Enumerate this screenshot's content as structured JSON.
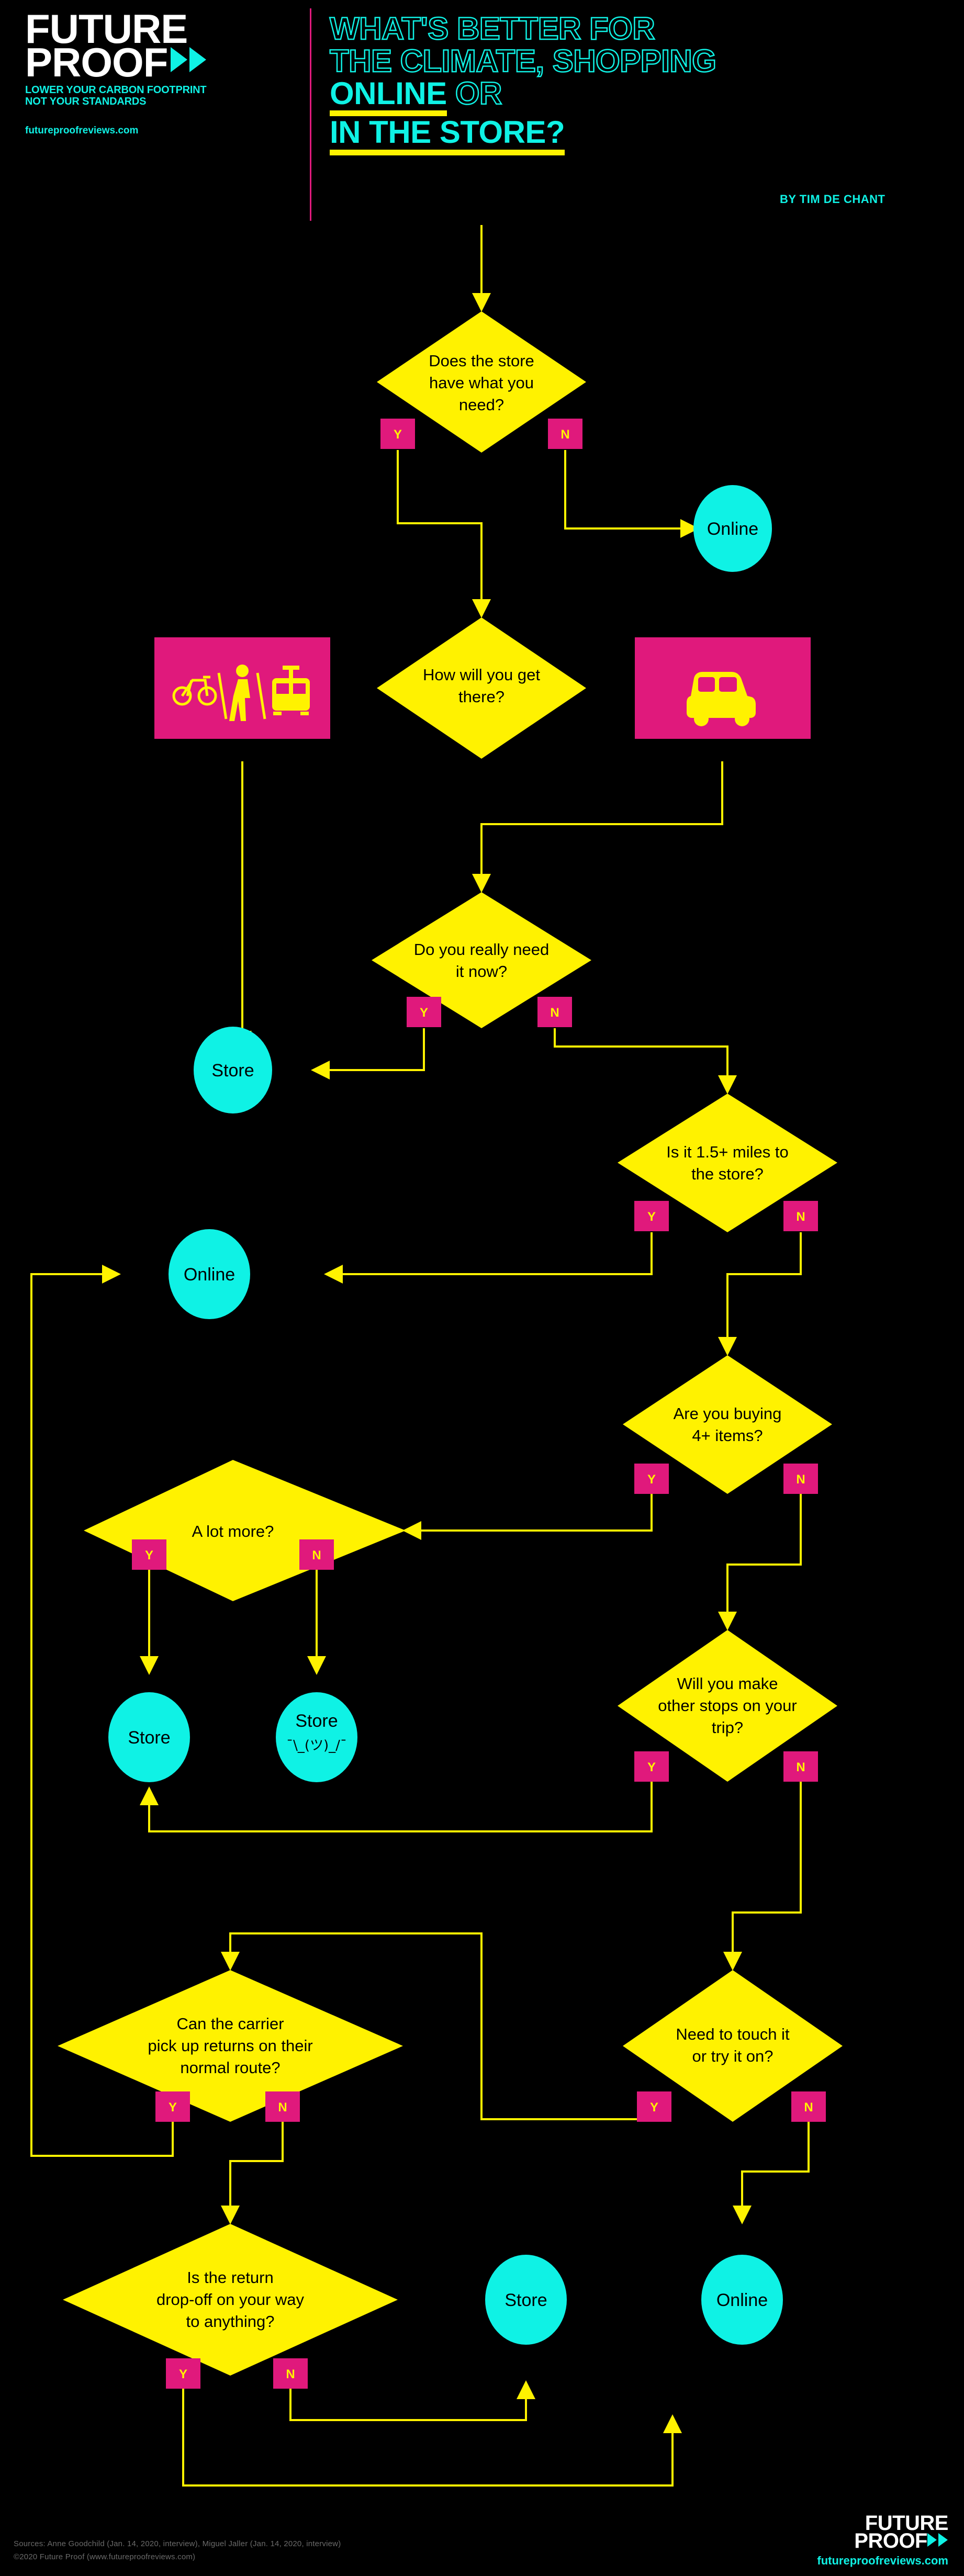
{
  "brand": {
    "name_line1": "FUTURE",
    "name_line2": "PROOF",
    "tagline_line1": "LOWER YOUR CARBON FOOTPRINT",
    "tagline_line2": "NOT YOUR STANDARDS",
    "url": "futureproofreviews.com"
  },
  "header": {
    "title_line1": "WHAT'S BETTER FOR",
    "title_line2": "THE CLIMATE, SHOPPING",
    "title_line3_hl": "ONLINE",
    "title_line3_rest": "OR",
    "title_line4": "IN THE STORE?",
    "byline": "BY TIM DE CHANT"
  },
  "colors": {
    "background": "#000000",
    "decision": "#FFF200",
    "terminal": "#0FF2E5",
    "branch_badge": "#E0197C",
    "connector": "#FFF200",
    "accent_rule": "#E0197C"
  },
  "flow": {
    "yes_label": "Y",
    "no_label": "N",
    "nodes": [
      {
        "id": "q1",
        "type": "decision",
        "lines": [
          "Does the store",
          "have what you",
          "need?"
        ]
      },
      {
        "id": "t1",
        "type": "terminal",
        "lines": [
          "Online"
        ]
      },
      {
        "id": "q2",
        "type": "decision",
        "lines": [
          "How will you get",
          "there?"
        ]
      },
      {
        "id": "m1",
        "type": "mode",
        "icon": "bike-walk-tram-icon",
        "label": "/ / "
      },
      {
        "id": "m2",
        "type": "mode",
        "icon": "car-icon",
        "label": ""
      },
      {
        "id": "q3",
        "type": "decision",
        "lines": [
          "Do you really need",
          "it now?"
        ]
      },
      {
        "id": "t2",
        "type": "terminal",
        "lines": [
          "Store"
        ]
      },
      {
        "id": "q4",
        "type": "decision",
        "lines": [
          "Is it 1.5+ miles to",
          "the store?"
        ]
      },
      {
        "id": "t3",
        "type": "terminal",
        "lines": [
          "Online"
        ]
      },
      {
        "id": "q5",
        "type": "decision",
        "lines": [
          "Are you buying",
          "4+ items?"
        ]
      },
      {
        "id": "q6",
        "type": "decision",
        "lines": [
          "A lot more?"
        ]
      },
      {
        "id": "t4",
        "type": "terminal",
        "lines": [
          "Store"
        ]
      },
      {
        "id": "t5",
        "type": "terminal",
        "lines": [
          "Store"
        ],
        "sub": "¯\\_(ツ)_/¯"
      },
      {
        "id": "q7",
        "type": "decision",
        "lines": [
          "Will you make",
          "other stops on your",
          "trip?"
        ]
      },
      {
        "id": "q8",
        "type": "decision",
        "lines": [
          "Can the carrier",
          "pick up returns on their",
          "normal route?"
        ]
      },
      {
        "id": "q9",
        "type": "decision",
        "lines": [
          "Need to touch it",
          "or try it on?"
        ]
      },
      {
        "id": "q10",
        "type": "decision",
        "lines": [
          "Is the return",
          "drop-off on your way",
          "to anything?"
        ]
      },
      {
        "id": "t6",
        "type": "terminal",
        "lines": [
          "Store"
        ]
      },
      {
        "id": "t7",
        "type": "terminal",
        "lines": [
          "Online"
        ]
      }
    ]
  },
  "footer": {
    "sources": "Sources: Anne Goodchild (Jan. 14, 2020, interview), Miguel Jaller (Jan. 14, 2020, interview)",
    "copyright": "©2020 Future Proof (www.futureproofreviews.com)"
  }
}
